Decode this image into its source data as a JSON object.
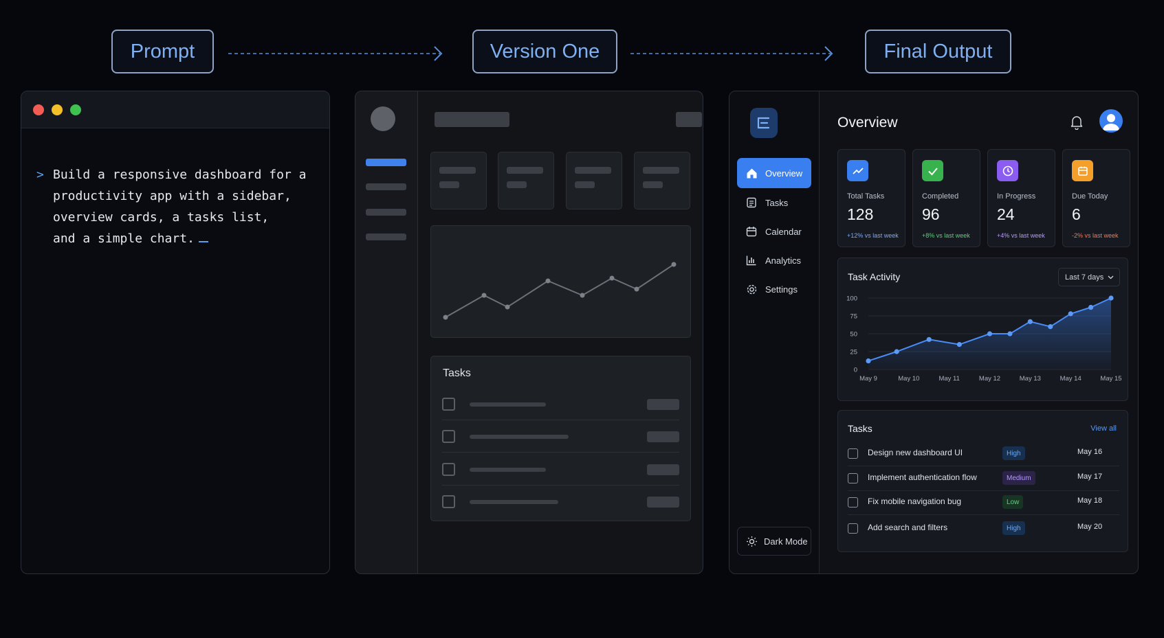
{
  "labels": {
    "prompt": "Prompt",
    "version_one": "Version One",
    "final_output": "Final Output"
  },
  "prompt_panel": {
    "lines": [
      "Build a responsive dashboard for a",
      "productivity app with a sidebar,",
      "overview cards, a tasks list,",
      "and a simple chart."
    ],
    "prompt_symbol": ">"
  },
  "version_one": {
    "tasks_title": "Tasks"
  },
  "final": {
    "sidebar": {
      "items": [
        {
          "label": "Overview",
          "icon": "home-icon"
        },
        {
          "label": "Tasks",
          "icon": "tasks-icon"
        },
        {
          "label": "Calendar",
          "icon": "calendar-icon"
        },
        {
          "label": "Analytics",
          "icon": "analytics-icon"
        },
        {
          "label": "Settings",
          "icon": "gear-icon"
        }
      ],
      "dark_mode": "Dark Mode"
    },
    "header": {
      "title": "Overview"
    },
    "stats": [
      {
        "label": "Total Tasks",
        "value": "128",
        "delta": "+12% vs last week",
        "color": "#3a7ff0",
        "delta_color": "#7fa8f5"
      },
      {
        "label": "Completed",
        "value": "96",
        "delta": "+8% vs last week",
        "color": "#37b24d",
        "delta_color": "#5fd07a"
      },
      {
        "label": "In Progress",
        "value": "24",
        "delta": "+4% vs last week",
        "color": "#8a5cf0",
        "delta_color": "#b59cf7"
      },
      {
        "label": "Due Today",
        "value": "6",
        "delta": "-2% vs last week",
        "color": "#f59f2b",
        "delta_color": "#f07a5a"
      }
    ],
    "activity": {
      "title": "Task Activity",
      "range": "Last 7 days"
    },
    "tasks": {
      "title": "Tasks",
      "view_all": "View all",
      "rows": [
        {
          "name": "Design new dashboard UI",
          "priority": "High",
          "date": "May 16"
        },
        {
          "name": "Implement authentication flow",
          "priority": "Medium",
          "date": "May 17"
        },
        {
          "name": "Fix mobile navigation bug",
          "priority": "Low",
          "date": "May 18"
        },
        {
          "name": "Add search and filters",
          "priority": "High",
          "date": "May 20"
        }
      ]
    }
  },
  "chart_data": {
    "type": "area",
    "title": "Task Activity",
    "x_ticks": [
      "May 9",
      "May 10",
      "May 11",
      "May 12",
      "May 13",
      "May 14",
      "May 15"
    ],
    "y_ticks": [
      0,
      25,
      50,
      75,
      100
    ],
    "ylim": [
      0,
      100
    ],
    "x": [
      9,
      9.7,
      10.5,
      11.25,
      12,
      12.5,
      13,
      13.5,
      14,
      14.5,
      15
    ],
    "values": [
      12,
      25,
      42,
      35,
      50,
      50,
      67,
      60,
      78,
      87,
      100
    ],
    "color": "#4a8cf5"
  }
}
